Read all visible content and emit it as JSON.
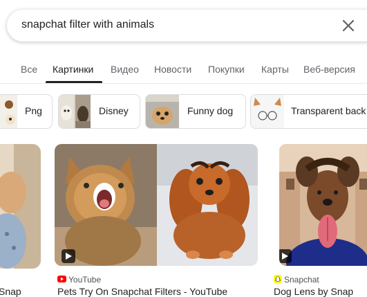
{
  "search": {
    "query": "snapchat filter with animals"
  },
  "tabs": [
    {
      "label": "Все"
    },
    {
      "label": "Картинки"
    },
    {
      "label": "Видео"
    },
    {
      "label": "Новости"
    },
    {
      "label": "Покупки"
    },
    {
      "label": "Карты"
    },
    {
      "label": "Веб-версия"
    }
  ],
  "active_tab": "Картинки",
  "chips": [
    {
      "label": "Png"
    },
    {
      "label": "Disney"
    },
    {
      "label": "Funny dog"
    },
    {
      "label": "Transparent back"
    }
  ],
  "results": [
    {
      "source": "",
      "caption": "Snap"
    },
    {
      "source": "YouTube",
      "caption": "Pets Try On Snapchat Filters - YouTube",
      "source_color": "#ff0000"
    },
    {
      "source": "Snapchat",
      "caption": "Dog Lens by Snap",
      "source_color": "#fffc00"
    }
  ],
  "colors": {
    "accent": "#202124",
    "muted": "#5f6368",
    "border": "#dadce0"
  }
}
